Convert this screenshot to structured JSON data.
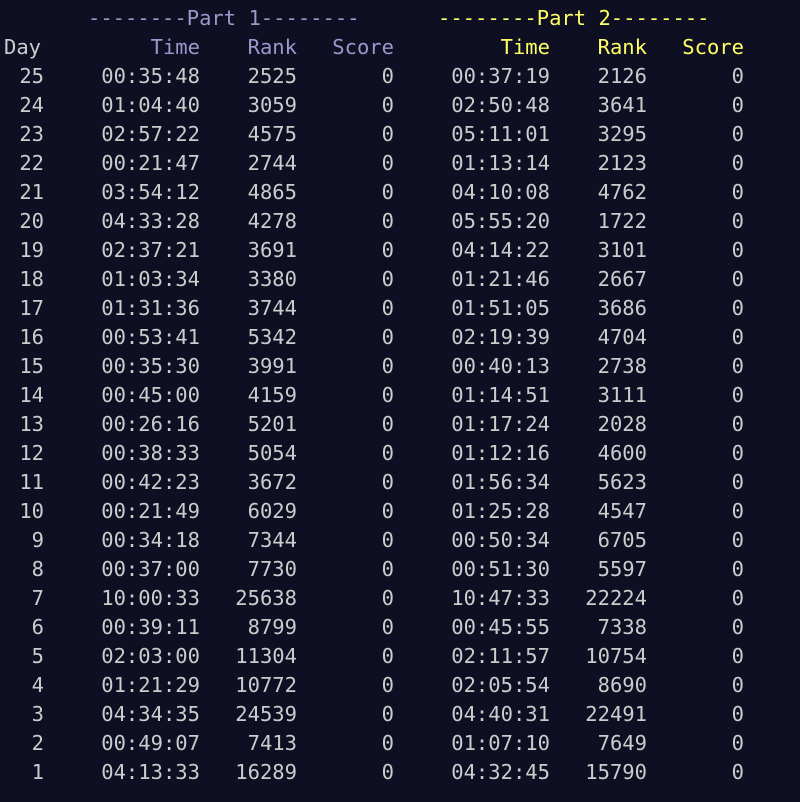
{
  "part1_header": "--------Part 1--------",
  "part2_header": "--------Part 2--------",
  "columns": {
    "day": "Day",
    "p1_time": "Time",
    "p1_rank": "Rank",
    "p1_score": "Score",
    "p2_time": "Time",
    "p2_rank": "Rank",
    "p2_score": "Score"
  },
  "colors": {
    "background": "#0f0f23",
    "text": "#cccccc",
    "part1_accent": "#9999cc",
    "part2_accent": "#ffff66"
  },
  "rows": [
    {
      "day": "25",
      "p1_time": "00:35:48",
      "p1_rank": "2525",
      "p1_score": "0",
      "p2_time": "00:37:19",
      "p2_rank": "2126",
      "p2_score": "0"
    },
    {
      "day": "24",
      "p1_time": "01:04:40",
      "p1_rank": "3059",
      "p1_score": "0",
      "p2_time": "02:50:48",
      "p2_rank": "3641",
      "p2_score": "0"
    },
    {
      "day": "23",
      "p1_time": "02:57:22",
      "p1_rank": "4575",
      "p1_score": "0",
      "p2_time": "05:11:01",
      "p2_rank": "3295",
      "p2_score": "0"
    },
    {
      "day": "22",
      "p1_time": "00:21:47",
      "p1_rank": "2744",
      "p1_score": "0",
      "p2_time": "01:13:14",
      "p2_rank": "2123",
      "p2_score": "0"
    },
    {
      "day": "21",
      "p1_time": "03:54:12",
      "p1_rank": "4865",
      "p1_score": "0",
      "p2_time": "04:10:08",
      "p2_rank": "4762",
      "p2_score": "0"
    },
    {
      "day": "20",
      "p1_time": "04:33:28",
      "p1_rank": "4278",
      "p1_score": "0",
      "p2_time": "05:55:20",
      "p2_rank": "1722",
      "p2_score": "0"
    },
    {
      "day": "19",
      "p1_time": "02:37:21",
      "p1_rank": "3691",
      "p1_score": "0",
      "p2_time": "04:14:22",
      "p2_rank": "3101",
      "p2_score": "0"
    },
    {
      "day": "18",
      "p1_time": "01:03:34",
      "p1_rank": "3380",
      "p1_score": "0",
      "p2_time": "01:21:46",
      "p2_rank": "2667",
      "p2_score": "0"
    },
    {
      "day": "17",
      "p1_time": "01:31:36",
      "p1_rank": "3744",
      "p1_score": "0",
      "p2_time": "01:51:05",
      "p2_rank": "3686",
      "p2_score": "0"
    },
    {
      "day": "16",
      "p1_time": "00:53:41",
      "p1_rank": "5342",
      "p1_score": "0",
      "p2_time": "02:19:39",
      "p2_rank": "4704",
      "p2_score": "0"
    },
    {
      "day": "15",
      "p1_time": "00:35:30",
      "p1_rank": "3991",
      "p1_score": "0",
      "p2_time": "00:40:13",
      "p2_rank": "2738",
      "p2_score": "0"
    },
    {
      "day": "14",
      "p1_time": "00:45:00",
      "p1_rank": "4159",
      "p1_score": "0",
      "p2_time": "01:14:51",
      "p2_rank": "3111",
      "p2_score": "0"
    },
    {
      "day": "13",
      "p1_time": "00:26:16",
      "p1_rank": "5201",
      "p1_score": "0",
      "p2_time": "01:17:24",
      "p2_rank": "2028",
      "p2_score": "0"
    },
    {
      "day": "12",
      "p1_time": "00:38:33",
      "p1_rank": "5054",
      "p1_score": "0",
      "p2_time": "01:12:16",
      "p2_rank": "4600",
      "p2_score": "0"
    },
    {
      "day": "11",
      "p1_time": "00:42:23",
      "p1_rank": "3672",
      "p1_score": "0",
      "p2_time": "01:56:34",
      "p2_rank": "5623",
      "p2_score": "0"
    },
    {
      "day": "10",
      "p1_time": "00:21:49",
      "p1_rank": "6029",
      "p1_score": "0",
      "p2_time": "01:25:28",
      "p2_rank": "4547",
      "p2_score": "0"
    },
    {
      "day": "9",
      "p1_time": "00:34:18",
      "p1_rank": "7344",
      "p1_score": "0",
      "p2_time": "00:50:34",
      "p2_rank": "6705",
      "p2_score": "0"
    },
    {
      "day": "8",
      "p1_time": "00:37:00",
      "p1_rank": "7730",
      "p1_score": "0",
      "p2_time": "00:51:30",
      "p2_rank": "5597",
      "p2_score": "0"
    },
    {
      "day": "7",
      "p1_time": "10:00:33",
      "p1_rank": "25638",
      "p1_score": "0",
      "p2_time": "10:47:33",
      "p2_rank": "22224",
      "p2_score": "0"
    },
    {
      "day": "6",
      "p1_time": "00:39:11",
      "p1_rank": "8799",
      "p1_score": "0",
      "p2_time": "00:45:55",
      "p2_rank": "7338",
      "p2_score": "0"
    },
    {
      "day": "5",
      "p1_time": "02:03:00",
      "p1_rank": "11304",
      "p1_score": "0",
      "p2_time": "02:11:57",
      "p2_rank": "10754",
      "p2_score": "0"
    },
    {
      "day": "4",
      "p1_time": "01:21:29",
      "p1_rank": "10772",
      "p1_score": "0",
      "p2_time": "02:05:54",
      "p2_rank": "8690",
      "p2_score": "0"
    },
    {
      "day": "3",
      "p1_time": "04:34:35",
      "p1_rank": "24539",
      "p1_score": "0",
      "p2_time": "04:40:31",
      "p2_rank": "22491",
      "p2_score": "0"
    },
    {
      "day": "2",
      "p1_time": "00:49:07",
      "p1_rank": "7413",
      "p1_score": "0",
      "p2_time": "01:07:10",
      "p2_rank": "7649",
      "p2_score": "0"
    },
    {
      "day": "1",
      "p1_time": "04:13:33",
      "p1_rank": "16289",
      "p1_score": "0",
      "p2_time": "04:32:45",
      "p2_rank": "15790",
      "p2_score": "0"
    }
  ]
}
